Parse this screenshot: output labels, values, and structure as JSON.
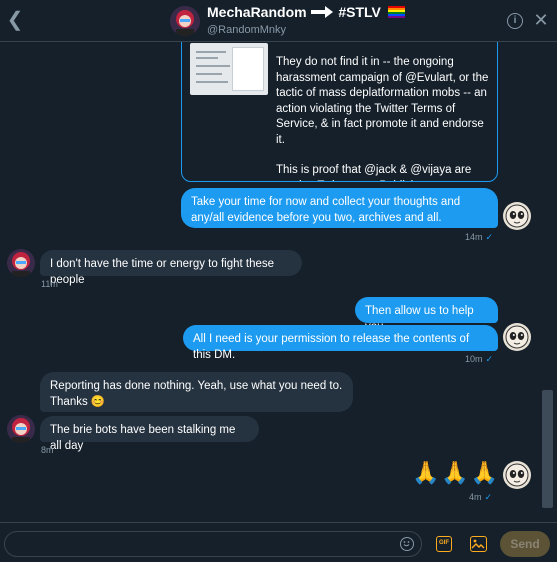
{
  "header": {
    "name": "MechaRandom",
    "hashtag": "#STLV",
    "handle": "@RandomMnky"
  },
  "quoted_tweet": {
    "paragraph1": "They do not find it in -- the ongoing harassment campaign of @Evulart, or the tactic of mass deplatformation mobs -- an action violating the Twitter Terms of Service, & in fact promote it and endorse it.",
    "paragraph2": "This is proof that @jack & @vijaya are running Twitter as a Publisher."
  },
  "messages": [
    {
      "id": "m1",
      "text": "Take your time for now and collect your thoughts and any/all evidence before you two, archives and all.",
      "time": "14m"
    },
    {
      "id": "m2",
      "text": "I don't have the time or energy to fight these people",
      "time": "11m"
    },
    {
      "id": "m3",
      "text": "Then allow us to help you."
    },
    {
      "id": "m4",
      "text": "All I need is your permission to release the contents of this DM.",
      "time": "10m"
    },
    {
      "id": "m5",
      "text": "Reporting has done nothing. Yeah, use what you need to. Thanks 😊"
    },
    {
      "id": "m6",
      "text": "The brie bots have been stalking me all day",
      "time": "8m"
    },
    {
      "id": "m7",
      "text": "🙏🙏🙏",
      "time": "4m"
    }
  ],
  "composer": {
    "placeholder": "",
    "gif_label": "GIF",
    "send_label": "Send"
  },
  "colors": {
    "background": "#15202b",
    "accent": "#1d9bf0",
    "incoming_bubble": "#253341",
    "gif_accent": "#ffad1f"
  }
}
